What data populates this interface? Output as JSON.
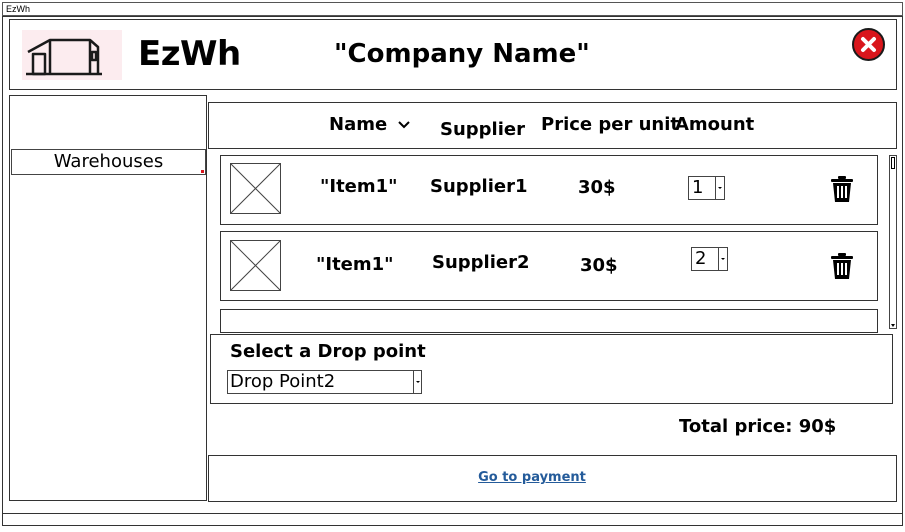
{
  "window": {
    "title": "EzWh"
  },
  "header": {
    "logo_icon": "warehouse-icon",
    "app_title": "EzWh",
    "company_name": "\"Company Name\"",
    "close_icon": "close-icon",
    "close_color": "#d9161c"
  },
  "sidebar": {
    "items": [
      {
        "label": "Warehouses"
      }
    ]
  },
  "table": {
    "columns": [
      "Name",
      "Supplier",
      "Price per unit",
      "Amount"
    ],
    "sort_icon": "chevron-down-icon",
    "rows": [
      {
        "image_icon": "image-placeholder-icon",
        "name": "\"Item1\"",
        "supplier": "Supplier1",
        "price": "30$",
        "amount": "1",
        "delete_icon": "trash-icon"
      },
      {
        "image_icon": "image-placeholder-icon",
        "name": "\"Item1\"",
        "supplier": "Supplier2",
        "price": "30$",
        "amount": "2",
        "delete_icon": "trash-icon"
      }
    ]
  },
  "drop_point": {
    "title": "Select a Drop point",
    "selected": "Drop Point2"
  },
  "total": {
    "label": "Total price: 90$"
  },
  "payment": {
    "link_label": "Go to payment",
    "link_color": "#245b9a"
  }
}
